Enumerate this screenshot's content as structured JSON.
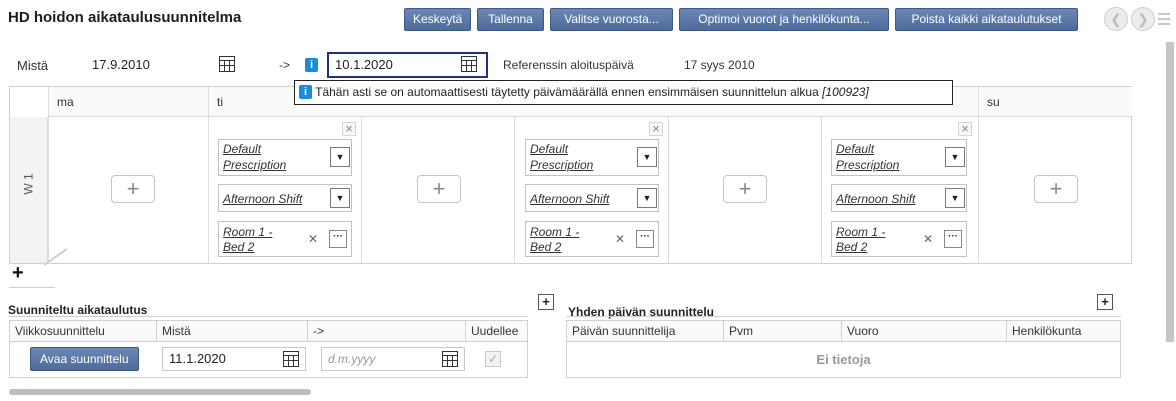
{
  "header": {
    "title": "HD hoidon aikataulusuunnitelma",
    "buttons": [
      "Keskeytä",
      "Tallenna",
      "Valitse vuorosta...",
      "Optimoi vuorot ja henkilökunta...",
      "Poista kaikki aikataulutukset"
    ]
  },
  "dates": {
    "from_label": "Mistä",
    "from_value": "17.9.2010",
    "arrow": "->",
    "to_value": "10.1.2020",
    "ref_label": "Referenssin aloituspäivä",
    "ref_value": "17 syys 2010"
  },
  "tooltip": {
    "text": "Tähän asti se on automaattisesti täytetty päivämäärällä ennen ensimmäisen suunnittelun alkua",
    "code": "[100923]"
  },
  "calendar": {
    "days": [
      "ma",
      "ti",
      "su"
    ],
    "week_label": "W 1",
    "prescription": "Default Prescription",
    "prescription_l1": "Default",
    "prescription_l2": "Prescription",
    "shift": "Afternoon Shift",
    "room_l1": "Room 1 -",
    "room_l2": "Bed 2"
  },
  "planned": {
    "title": "Suunniteltu aikataulutus",
    "columns": [
      "Viikkosuunnittelu",
      "Mistä",
      "->",
      "Uudellee"
    ],
    "open_button": "Avaa suunnittelu",
    "from_value": "11.1.2020",
    "to_placeholder": "d.m.yyyy"
  },
  "single_day": {
    "title": "Yhden päivän suunnittelu",
    "columns": [
      "Päivän suunnittelija",
      "Pvm",
      "Vuoro",
      "Henkilökunta"
    ],
    "empty": "Ei tietoja"
  },
  "icons": {
    "calendar": "calendar-icon",
    "info": "info-icon",
    "plus": "plus-icon",
    "close": "close-icon",
    "dropdown": "chevron-down-icon",
    "more": "more-icon",
    "nav": [
      "prev-icon",
      "next-icon",
      "menu-icon"
    ]
  },
  "colors": {
    "button": "#5b77a8",
    "info": "#1a8cd8",
    "focus_border": "#1d2f8f"
  }
}
